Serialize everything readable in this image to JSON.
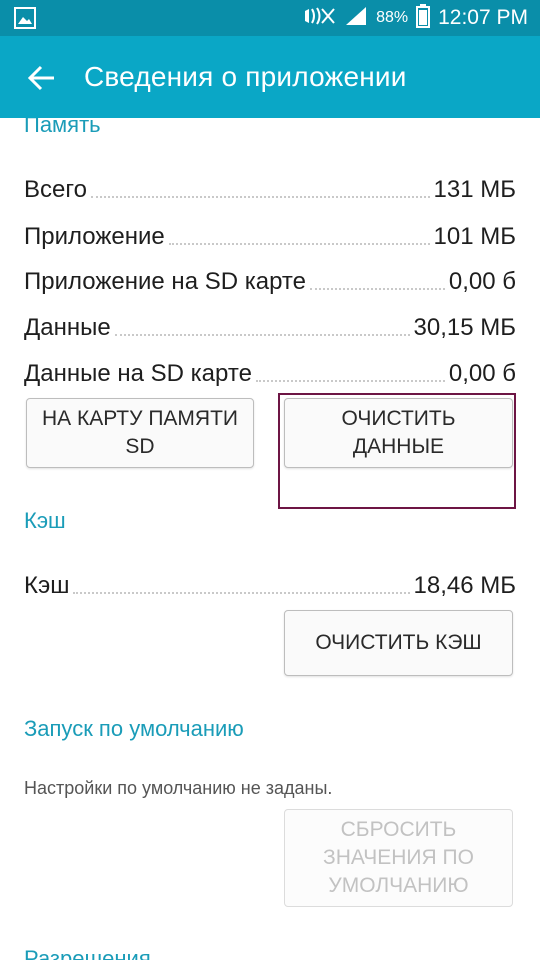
{
  "status_bar": {
    "battery_percent": "88%",
    "time": "12:07 PM",
    "icons": [
      "gallery-icon",
      "mute-icon",
      "signal-icon",
      "battery-icon"
    ]
  },
  "header": {
    "title": "Сведения о приложении"
  },
  "storage": {
    "header": "Память",
    "rows": [
      {
        "label": "Всего",
        "value": "131 МБ"
      },
      {
        "label": "Приложение",
        "value": "101 МБ"
      },
      {
        "label": "Приложение на SD карте",
        "value": "0,00 б"
      },
      {
        "label": "Данные",
        "value": "30,15 МБ"
      },
      {
        "label": "Данные на SD карте",
        "value": "0,00 б"
      }
    ],
    "move_button": "НА КАРТУ ПАМЯТИ SD",
    "clear_data_button": "ОЧИСТИТЬ ДАННЫЕ"
  },
  "cache": {
    "header": "Кэш",
    "row": {
      "label": "Кэш",
      "value": "18,46 МБ"
    },
    "clear_cache_button": "ОЧИСТИТЬ КЭШ"
  },
  "launch_default": {
    "header": "Запуск по умолчанию",
    "text": "Настройки по умолчанию не заданы.",
    "reset_button": "СБРОСИТЬ ЗНАЧЕНИЯ ПО УМОЛЧАНИЮ"
  },
  "permissions": {
    "header": "Разрешения"
  },
  "colors": {
    "status_bar": "#0a8ea9",
    "app_bar": "#0aa7c6",
    "section_header": "#1a9cb8",
    "highlight": "#6d1544"
  }
}
